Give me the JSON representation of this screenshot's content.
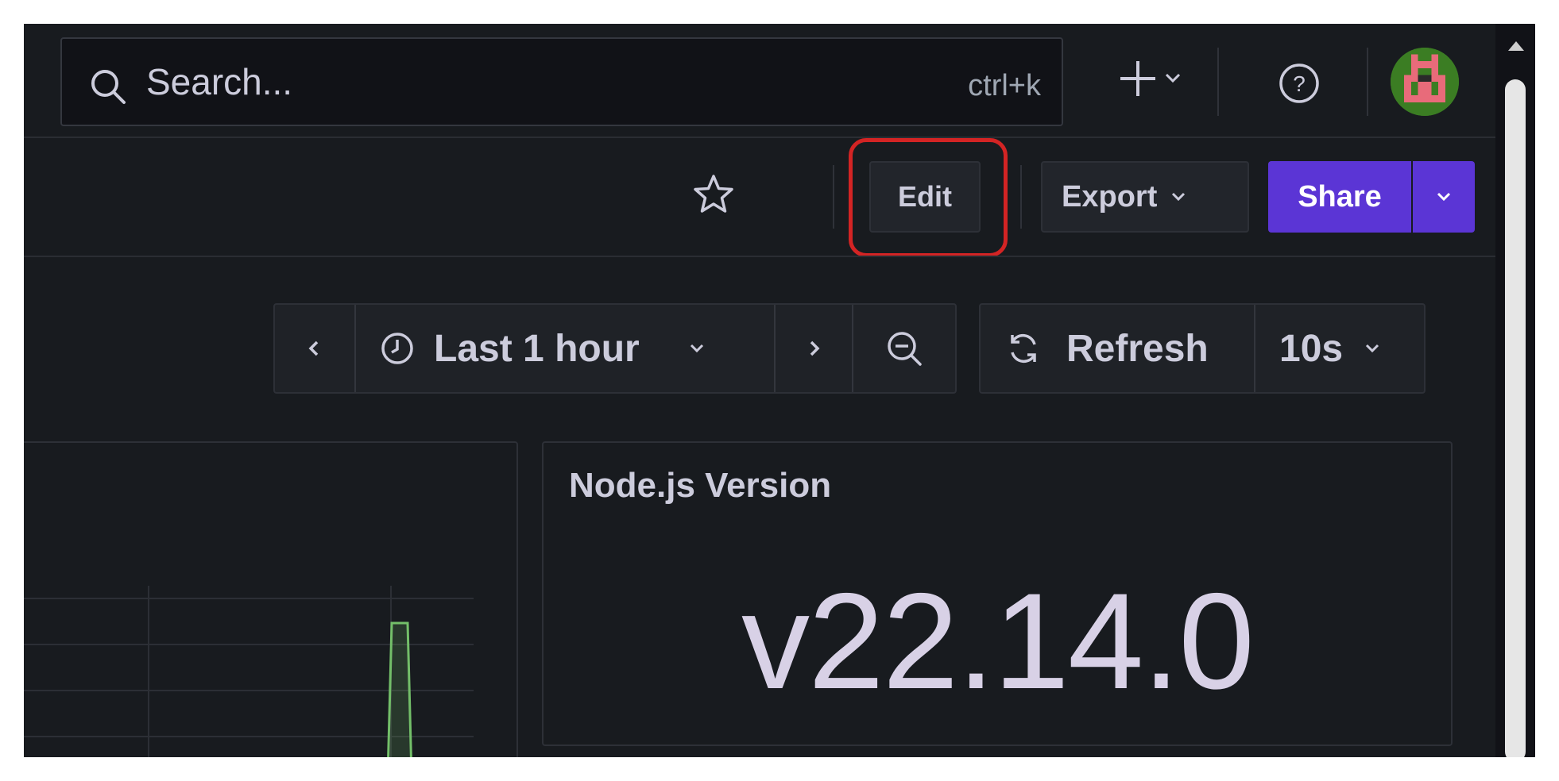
{
  "topbar": {
    "search_placeholder": "Search...",
    "search_shortcut": "ctrl+k",
    "icons": {
      "search": "search-icon",
      "new": "plus-icon",
      "help": "help-circle-icon",
      "avatar": "user-avatar"
    }
  },
  "toolbar": {
    "edit_label": "Edit",
    "export_label": "Export",
    "share_label": "Share",
    "share_color": "#5b35d5",
    "highlight_color": "#d32424"
  },
  "time_controls": {
    "range_label": "Last 1 hour",
    "refresh_label": "Refresh",
    "interval_label": "10s"
  },
  "panels": {
    "stat": {
      "title": "Node.js Version",
      "value": "v22.14.0"
    },
    "graph": {
      "series_color": "#73bf69"
    }
  }
}
